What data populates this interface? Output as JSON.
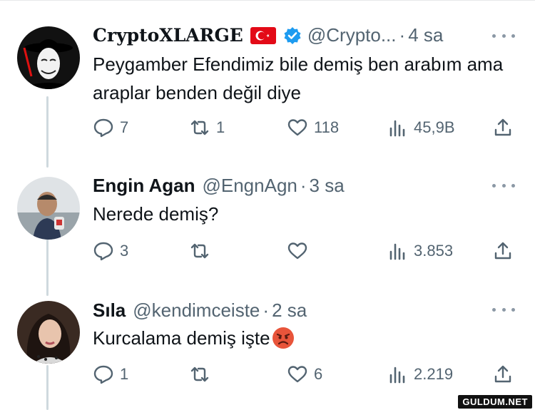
{
  "tweets": [
    {
      "name": "CryptoXLARGE",
      "handle": "@Crypto...",
      "time": "4 sa",
      "text": "Peygamber Efendimiz bile demiş ben arabım ama araplar benden değil diye",
      "replies": "7",
      "retweets": "1",
      "likes": "118",
      "views": "45,9B"
    },
    {
      "name": "Engin Agan",
      "handle": "@EngnAgn",
      "time": "3 sa",
      "text": "Nerede demiş?",
      "replies": "3",
      "retweets": "",
      "likes": "",
      "views": "3.853"
    },
    {
      "name": "Sıla",
      "handle": "@kendimceiste",
      "time": "2 sa",
      "text": "Kurcalama demiş işte",
      "replies": "1",
      "retweets": "",
      "likes": "6",
      "views": "2.219"
    }
  ],
  "watermark": "GULDUM.NET",
  "colors": {
    "verified": "#1d9bf0",
    "flag": "#e30a17",
    "muted": "#536471",
    "thread": "#cfd9de"
  },
  "icons": [
    "reply-icon",
    "retweet-icon",
    "like-icon",
    "views-icon",
    "share-icon",
    "more-icon",
    "verified-badge-icon",
    "turkish-flag-icon",
    "angry-face-emoji"
  ]
}
